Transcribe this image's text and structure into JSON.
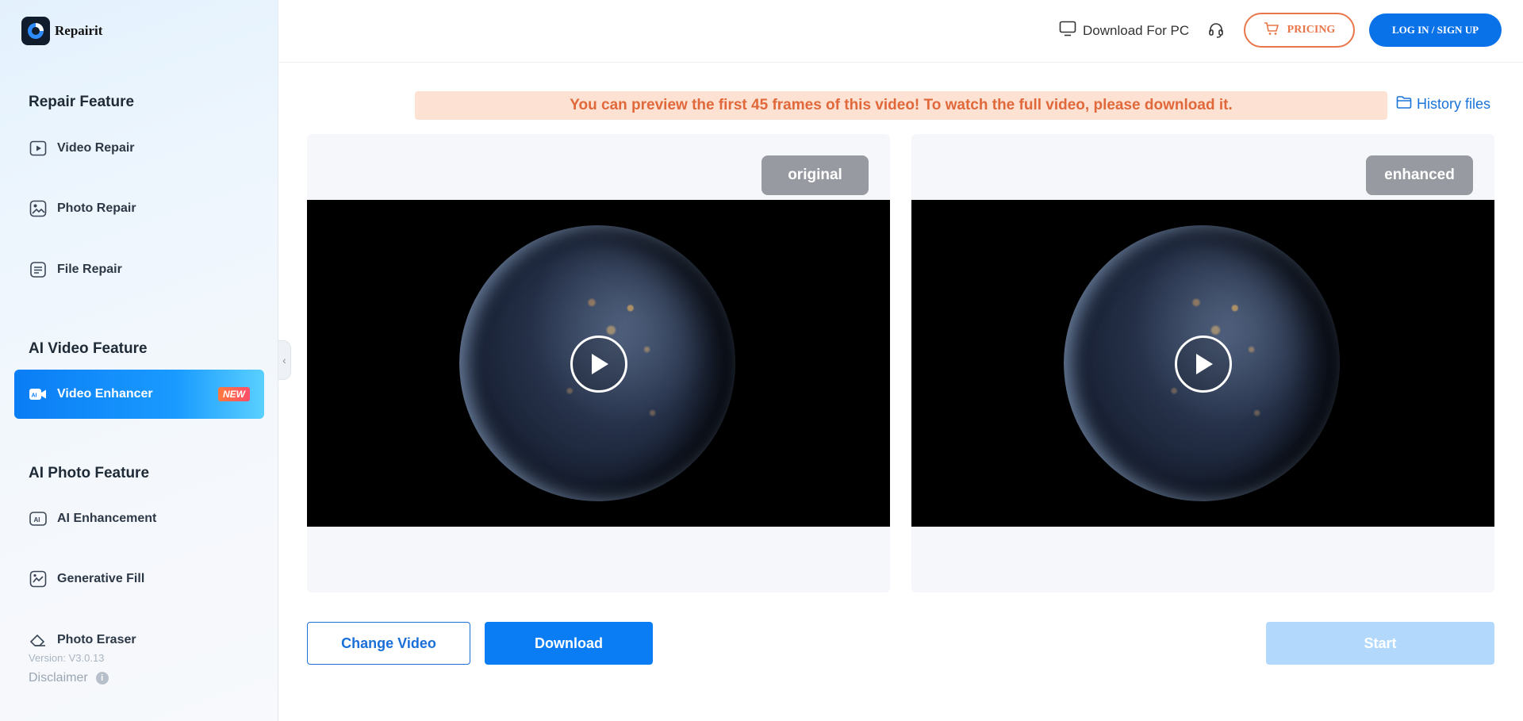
{
  "app": {
    "name": "Repairit"
  },
  "sidebar": {
    "sections": [
      {
        "title": "Repair Feature",
        "items": [
          {
            "label": "Video Repair",
            "icon": "video-play-icon"
          },
          {
            "label": "Photo Repair",
            "icon": "photo-icon"
          },
          {
            "label": "File Repair",
            "icon": "file-icon"
          }
        ]
      },
      {
        "title": "AI Video Feature",
        "items": [
          {
            "label": "Video Enhancer",
            "icon": "video-camera-ai-icon",
            "badge": "NEW",
            "active": true
          }
        ]
      },
      {
        "title": "AI Photo Feature",
        "items": [
          {
            "label": "AI Enhancement",
            "icon": "ai-icon"
          },
          {
            "label": "Generative Fill",
            "icon": "generative-fill-icon"
          },
          {
            "label": "Photo Eraser",
            "icon": "eraser-icon"
          }
        ]
      }
    ],
    "version": "Version: V3.0.13",
    "disclaimer": "Disclaimer"
  },
  "topbar": {
    "download_pc": "Download For PC",
    "pricing": "PRICING",
    "login": "LOG IN / SIGN UP"
  },
  "notice": {
    "text": "You can preview the first 45 frames of this video! To watch the full video, please download it.",
    "history": "History files"
  },
  "panels": {
    "left_tag": "original",
    "right_tag": "enhanced"
  },
  "actions": {
    "change": "Change Video",
    "download": "Download",
    "start": "Start"
  },
  "colors": {
    "accent": "#0a7df5",
    "pricing": "#e8764a",
    "notice_bg": "#fde2d3",
    "notice_text": "#e0683a"
  }
}
